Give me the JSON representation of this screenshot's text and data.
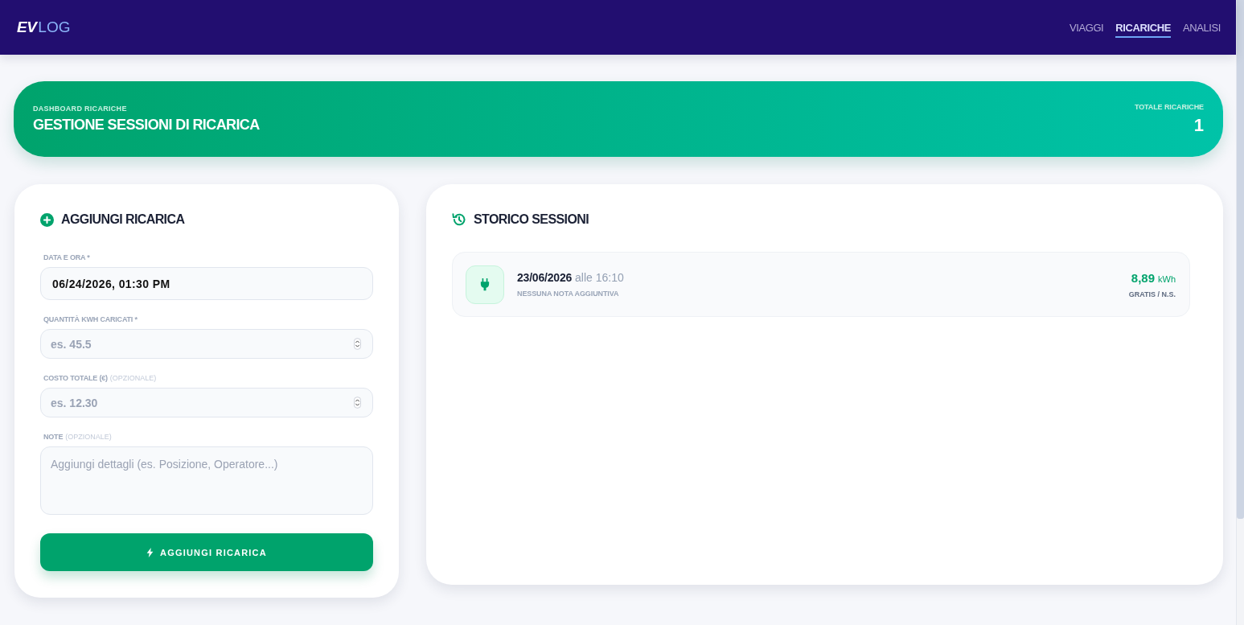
{
  "header": {
    "logo": {
      "bold": "EV",
      "light": "LOG"
    },
    "nav": [
      {
        "label": "VIAGGI",
        "selected": false
      },
      {
        "label": "RICARICHE",
        "selected": true
      },
      {
        "label": "ANALISI",
        "selected": false
      }
    ]
  },
  "banner": {
    "eyebrow": "DASHBOARD RICARICHE",
    "title": "GESTIONE SESSIONI DI RICARICA",
    "stat_label": "TOTALE RICARICHE",
    "stat_value": "1"
  },
  "form": {
    "title": "AGGIUNGI RICARICA",
    "fields": [
      {
        "kind": "datetime",
        "label": "DATA E ORA *",
        "value": "06/24/2026, 01:30 PM"
      },
      {
        "kind": "number",
        "label": "QUANTITÀ KWH CARICATI *",
        "placeholder": "es. 45.5"
      },
      {
        "kind": "number",
        "label": "COSTO TOTALE (€)",
        "hint": "(OPZIONALE)",
        "placeholder": "es. 12.30"
      },
      {
        "kind": "textarea",
        "label": "NOTE",
        "hint": "(OPZIONALE)",
        "placeholder": "Aggiungi dettagli (es. Posizione, Operatore...)"
      }
    ],
    "submit": "AGGIUNGI RICARICA"
  },
  "history": {
    "title": "STORICO SESSIONI",
    "sessions": [
      {
        "date": "23/06/2026",
        "time": "alle 16:10",
        "note": "NESSUNA NOTA AGGIUNTIVA",
        "energy": "8,89",
        "unit": "kWh",
        "cost": "GRATIS / N.S."
      }
    ]
  }
}
